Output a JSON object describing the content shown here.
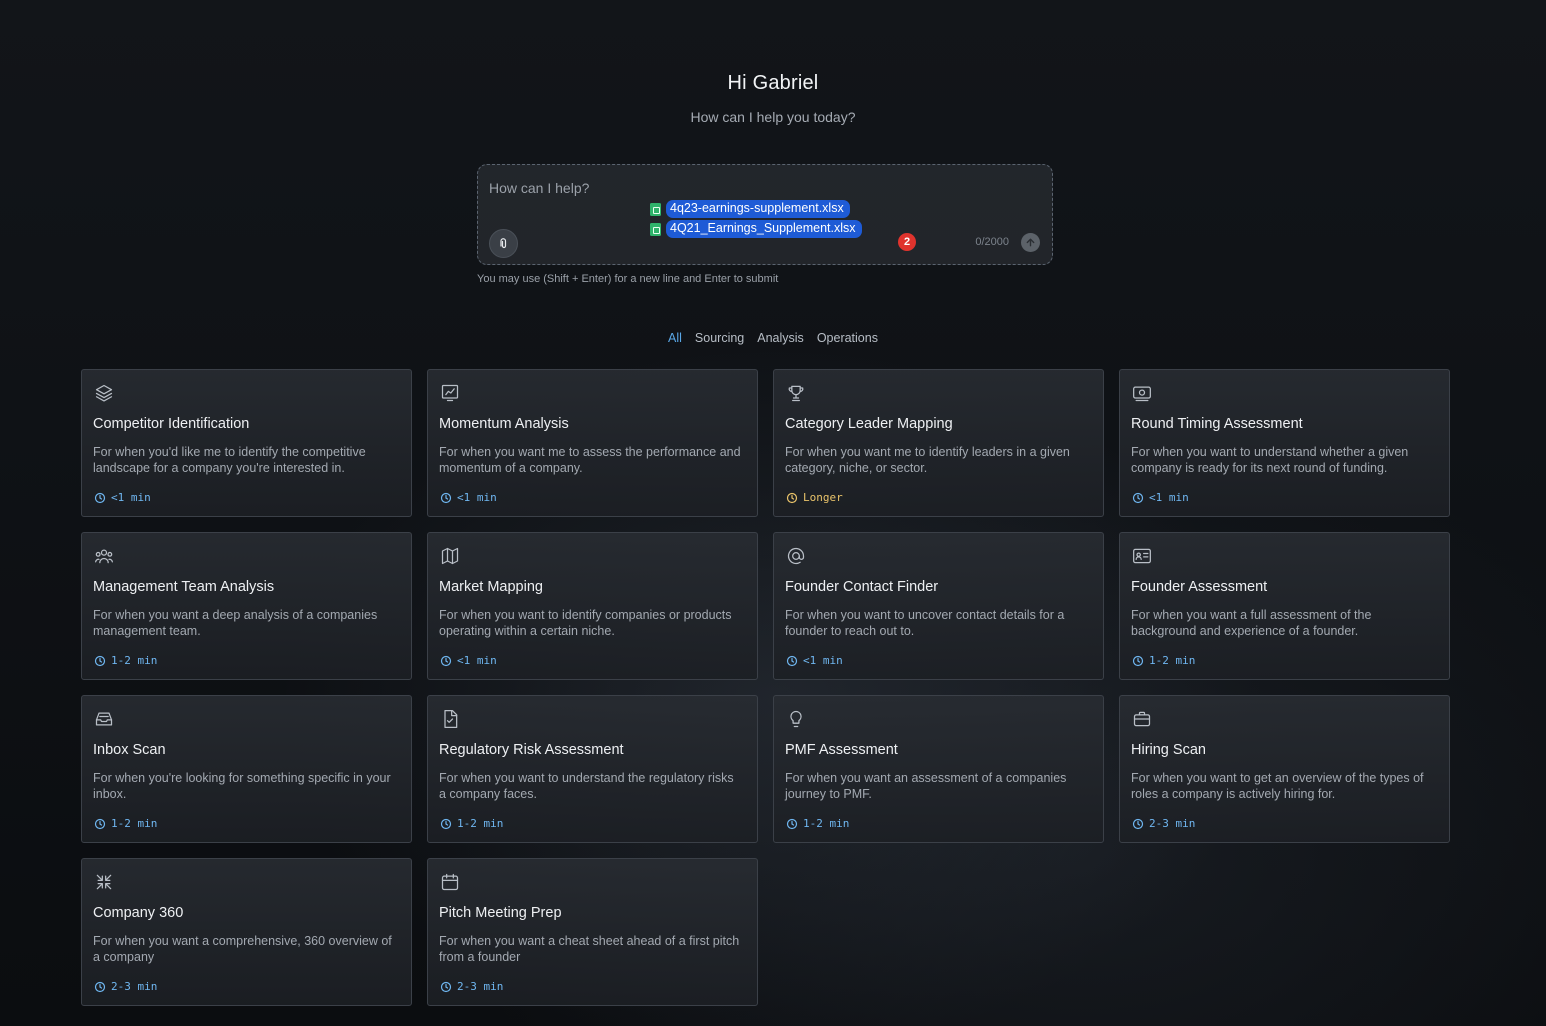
{
  "header": {
    "greeting": "Hi Gabriel",
    "subtitle": "How can I help you today?"
  },
  "composer": {
    "placeholder": "How can I help?",
    "attachments": [
      {
        "name": "4q23-earnings-supplement.xlsx",
        "icon": "spreadsheet-icon"
      },
      {
        "name": "4Q21_Earnings_Supplement.xlsx",
        "icon": "spreadsheet-icon"
      }
    ],
    "badge_count": "2",
    "char_count": "0/2000",
    "hint": "You may use (Shift + Enter) for a new line and Enter to submit"
  },
  "filters": [
    {
      "label": "All",
      "active": true
    },
    {
      "label": "Sourcing",
      "active": false
    },
    {
      "label": "Analysis",
      "active": false
    },
    {
      "label": "Operations",
      "active": false
    }
  ],
  "colors": {
    "accent": "#5aa7e6",
    "time": "#6fb6f0",
    "longer": "#e9c36a",
    "badge": "#e0332d",
    "file_highlight": "#1e5bd6"
  },
  "cards": [
    {
      "icon": "layers-icon",
      "title": "Competitor Identification",
      "desc": "For when you'd like me to identify the competitive landscape for a company you're interested in.",
      "time": "<1 min"
    },
    {
      "icon": "chart-icon",
      "title": "Momentum Analysis",
      "desc": "For when you want me to assess the performance and momentum of a company.",
      "time": "<1 min"
    },
    {
      "icon": "trophy-icon",
      "title": "Category Leader Mapping",
      "desc": "For when you want me to identify leaders in a given category, niche, or sector.",
      "time": "Longer"
    },
    {
      "icon": "money-icon",
      "title": "Round Timing Assessment",
      "desc": "For when you want to understand whether a given company is ready for its next round of funding.",
      "time": "<1 min"
    },
    {
      "icon": "team-icon",
      "title": "Management Team Analysis",
      "desc": "For when you want a deep analysis of a companies management team.",
      "time": "1-2 min"
    },
    {
      "icon": "map-icon",
      "title": "Market Mapping",
      "desc": "For when you want to identify companies or products operating within a certain niche.",
      "time": "<1 min"
    },
    {
      "icon": "at-icon",
      "title": "Founder Contact Finder",
      "desc": "For when you want to uncover contact details for a founder to reach out to.",
      "time": "<1 min"
    },
    {
      "icon": "id-card-icon",
      "title": "Founder Assessment",
      "desc": "For when you want a full assessment of the background and experience of a founder.",
      "time": "1-2 min"
    },
    {
      "icon": "inbox-icon",
      "title": "Inbox Scan",
      "desc": "For when you're looking for something specific in your inbox.",
      "time": "1-2 min"
    },
    {
      "icon": "file-check-icon",
      "title": "Regulatory Risk Assessment",
      "desc": "For when you want to understand the regulatory risks a company faces.",
      "time": "1-2 min"
    },
    {
      "icon": "lightbulb-icon",
      "title": "PMF Assessment",
      "desc": "For when you want an assessment of a companies journey to PMF.",
      "time": "1-2 min"
    },
    {
      "icon": "briefcase-icon",
      "title": "Hiring Scan",
      "desc": "For when you want to get an overview of the types of roles a company is actively hiring for.",
      "time": "2-3 min"
    },
    {
      "icon": "collapse-icon",
      "title": "Company 360",
      "desc": "For when you want a comprehensive, 360 overview of a company",
      "time": "2-3 min"
    },
    {
      "icon": "calendar-icon",
      "title": "Pitch Meeting Prep",
      "desc": "For when you want a cheat sheet ahead of a first pitch from a founder",
      "time": "2-3 min"
    }
  ]
}
